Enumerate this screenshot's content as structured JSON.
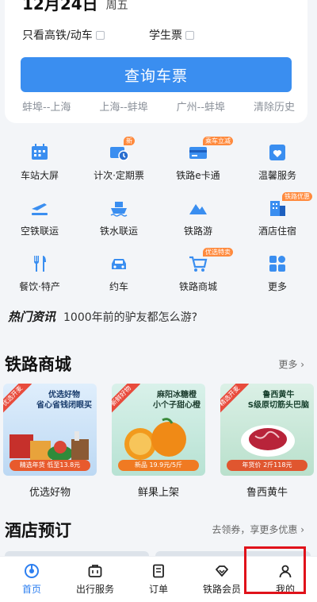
{
  "search": {
    "date": "12月24日",
    "weekday": "周五",
    "options": [
      "只看高铁/动车",
      "学生票"
    ],
    "query_label": "查询车票",
    "history": [
      "蚌埠--上海",
      "上海--蚌埠",
      "广州--蚌埠",
      "清除历史"
    ]
  },
  "services": [
    {
      "label": "车站大屏",
      "icon": "station-screen-icon",
      "badge": ""
    },
    {
      "label": "计次·定期票",
      "icon": "ticket-card-icon",
      "badge": "新"
    },
    {
      "label": "铁路e卡通",
      "icon": "ecard-icon",
      "badge": "乘车立减"
    },
    {
      "label": "温馨服务",
      "icon": "heart-service-icon",
      "badge": ""
    },
    {
      "label": "空铁联运",
      "icon": "plane-train-icon",
      "badge": ""
    },
    {
      "label": "铁水联运",
      "icon": "ship-train-icon",
      "badge": ""
    },
    {
      "label": "铁路游",
      "icon": "mountain-icon",
      "badge": ""
    },
    {
      "label": "酒店住宿",
      "icon": "hotel-icon",
      "badge": "铁路优惠"
    },
    {
      "label": "餐饮·特产",
      "icon": "fork-knife-icon",
      "badge": ""
    },
    {
      "label": "约车",
      "icon": "car-icon",
      "badge": ""
    },
    {
      "label": "铁路商城",
      "icon": "cart-icon",
      "badge": "优选特卖"
    },
    {
      "label": "更多",
      "icon": "more-grid-icon",
      "badge": ""
    }
  ],
  "news": {
    "tag": "热门资讯",
    "headline": "1000年前的驴友都怎么游?"
  },
  "mall": {
    "title": "铁路商城",
    "more": "更多",
    "products": [
      {
        "name": "优选好物",
        "ribbon": "优选开麦",
        "text": "优选好物\n省心省钱闭眼买",
        "price": "精选年货 低至13.8元"
      },
      {
        "name": "鲜果上架",
        "ribbon": "新鲜好物",
        "text": "麻阳冰糖橙\n小个子甜心橙",
        "price": "新品 19.9元/5斤"
      },
      {
        "name": "鲁西黄牛",
        "ribbon": "精选开麦",
        "text": "鲁西黄牛\nS级原切筋头巴脑",
        "price": "年货价 2斤118元"
      }
    ]
  },
  "hotel": {
    "title": "酒店预订",
    "more": "去领券，享更多优惠"
  },
  "tabbar": [
    {
      "label": "首页",
      "icon": "home-icon"
    },
    {
      "label": "出行服务",
      "icon": "travel-bag-icon"
    },
    {
      "label": "订单",
      "icon": "order-icon"
    },
    {
      "label": "铁路会员",
      "icon": "member-diamond-icon"
    },
    {
      "label": "我的",
      "icon": "profile-icon"
    }
  ],
  "colors": {
    "accent": "#3a8ef0",
    "badge": "#ff8a3d",
    "highlight": "#e0121a"
  }
}
